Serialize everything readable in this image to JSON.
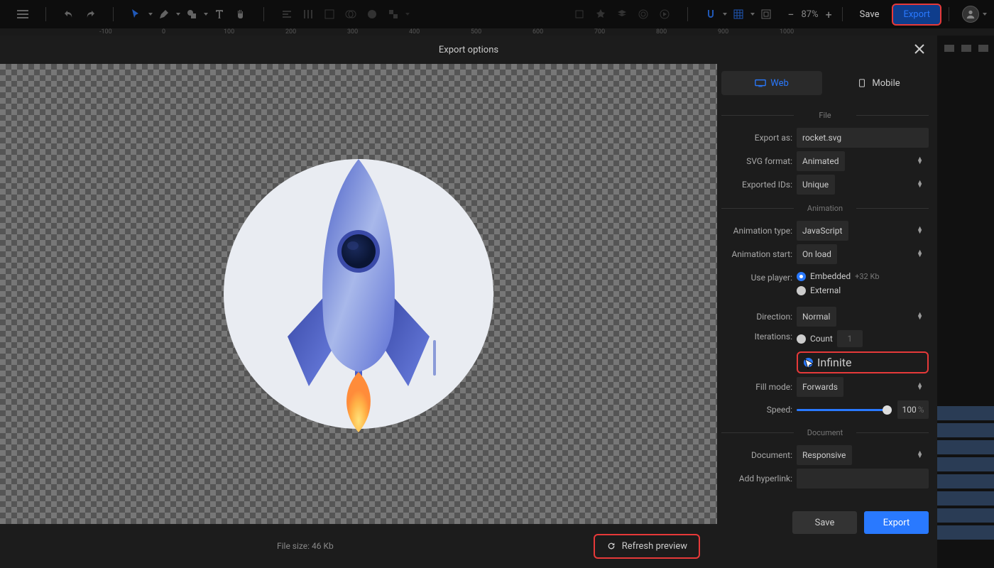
{
  "toolbar": {
    "zoom": "87%",
    "save": "Save",
    "export": "Export"
  },
  "ruler": [
    "-100",
    "0",
    "100",
    "200",
    "300",
    "400",
    "500",
    "600",
    "700",
    "800",
    "900",
    "1000"
  ],
  "modal": {
    "title": "Export options",
    "tab_web": "Web",
    "tab_mobile": "Mobile",
    "sections": {
      "file": "File",
      "animation": "Animation",
      "document": "Document"
    },
    "labels": {
      "export_as": "Export as:",
      "svg_format": "SVG format:",
      "exported_ids": "Exported IDs:",
      "animation_type": "Animation type:",
      "animation_start": "Animation start:",
      "use_player": "Use player:",
      "direction": "Direction:",
      "iterations": "Iterations:",
      "fill_mode": "Fill mode:",
      "speed": "Speed:",
      "document": "Document:",
      "add_hyperlink": "Add hyperlink:"
    },
    "values": {
      "export_as": "rocket.svg",
      "svg_format": "Animated",
      "exported_ids": "Unique",
      "animation_type": "JavaScript",
      "animation_start": "On load",
      "player_embedded": "Embedded",
      "player_embedded_size": "+32 Kb",
      "player_external": "External",
      "direction": "Normal",
      "iter_count": "Count",
      "iter_count_val": "1",
      "iter_infinite": "Infinite",
      "fill_mode": "Forwards",
      "speed": "100",
      "document": "Responsive",
      "hyperlink": ""
    },
    "footer": {
      "filesize": "File size: 46 Kb",
      "refresh": "Refresh preview",
      "save": "Save",
      "export": "Export"
    }
  }
}
